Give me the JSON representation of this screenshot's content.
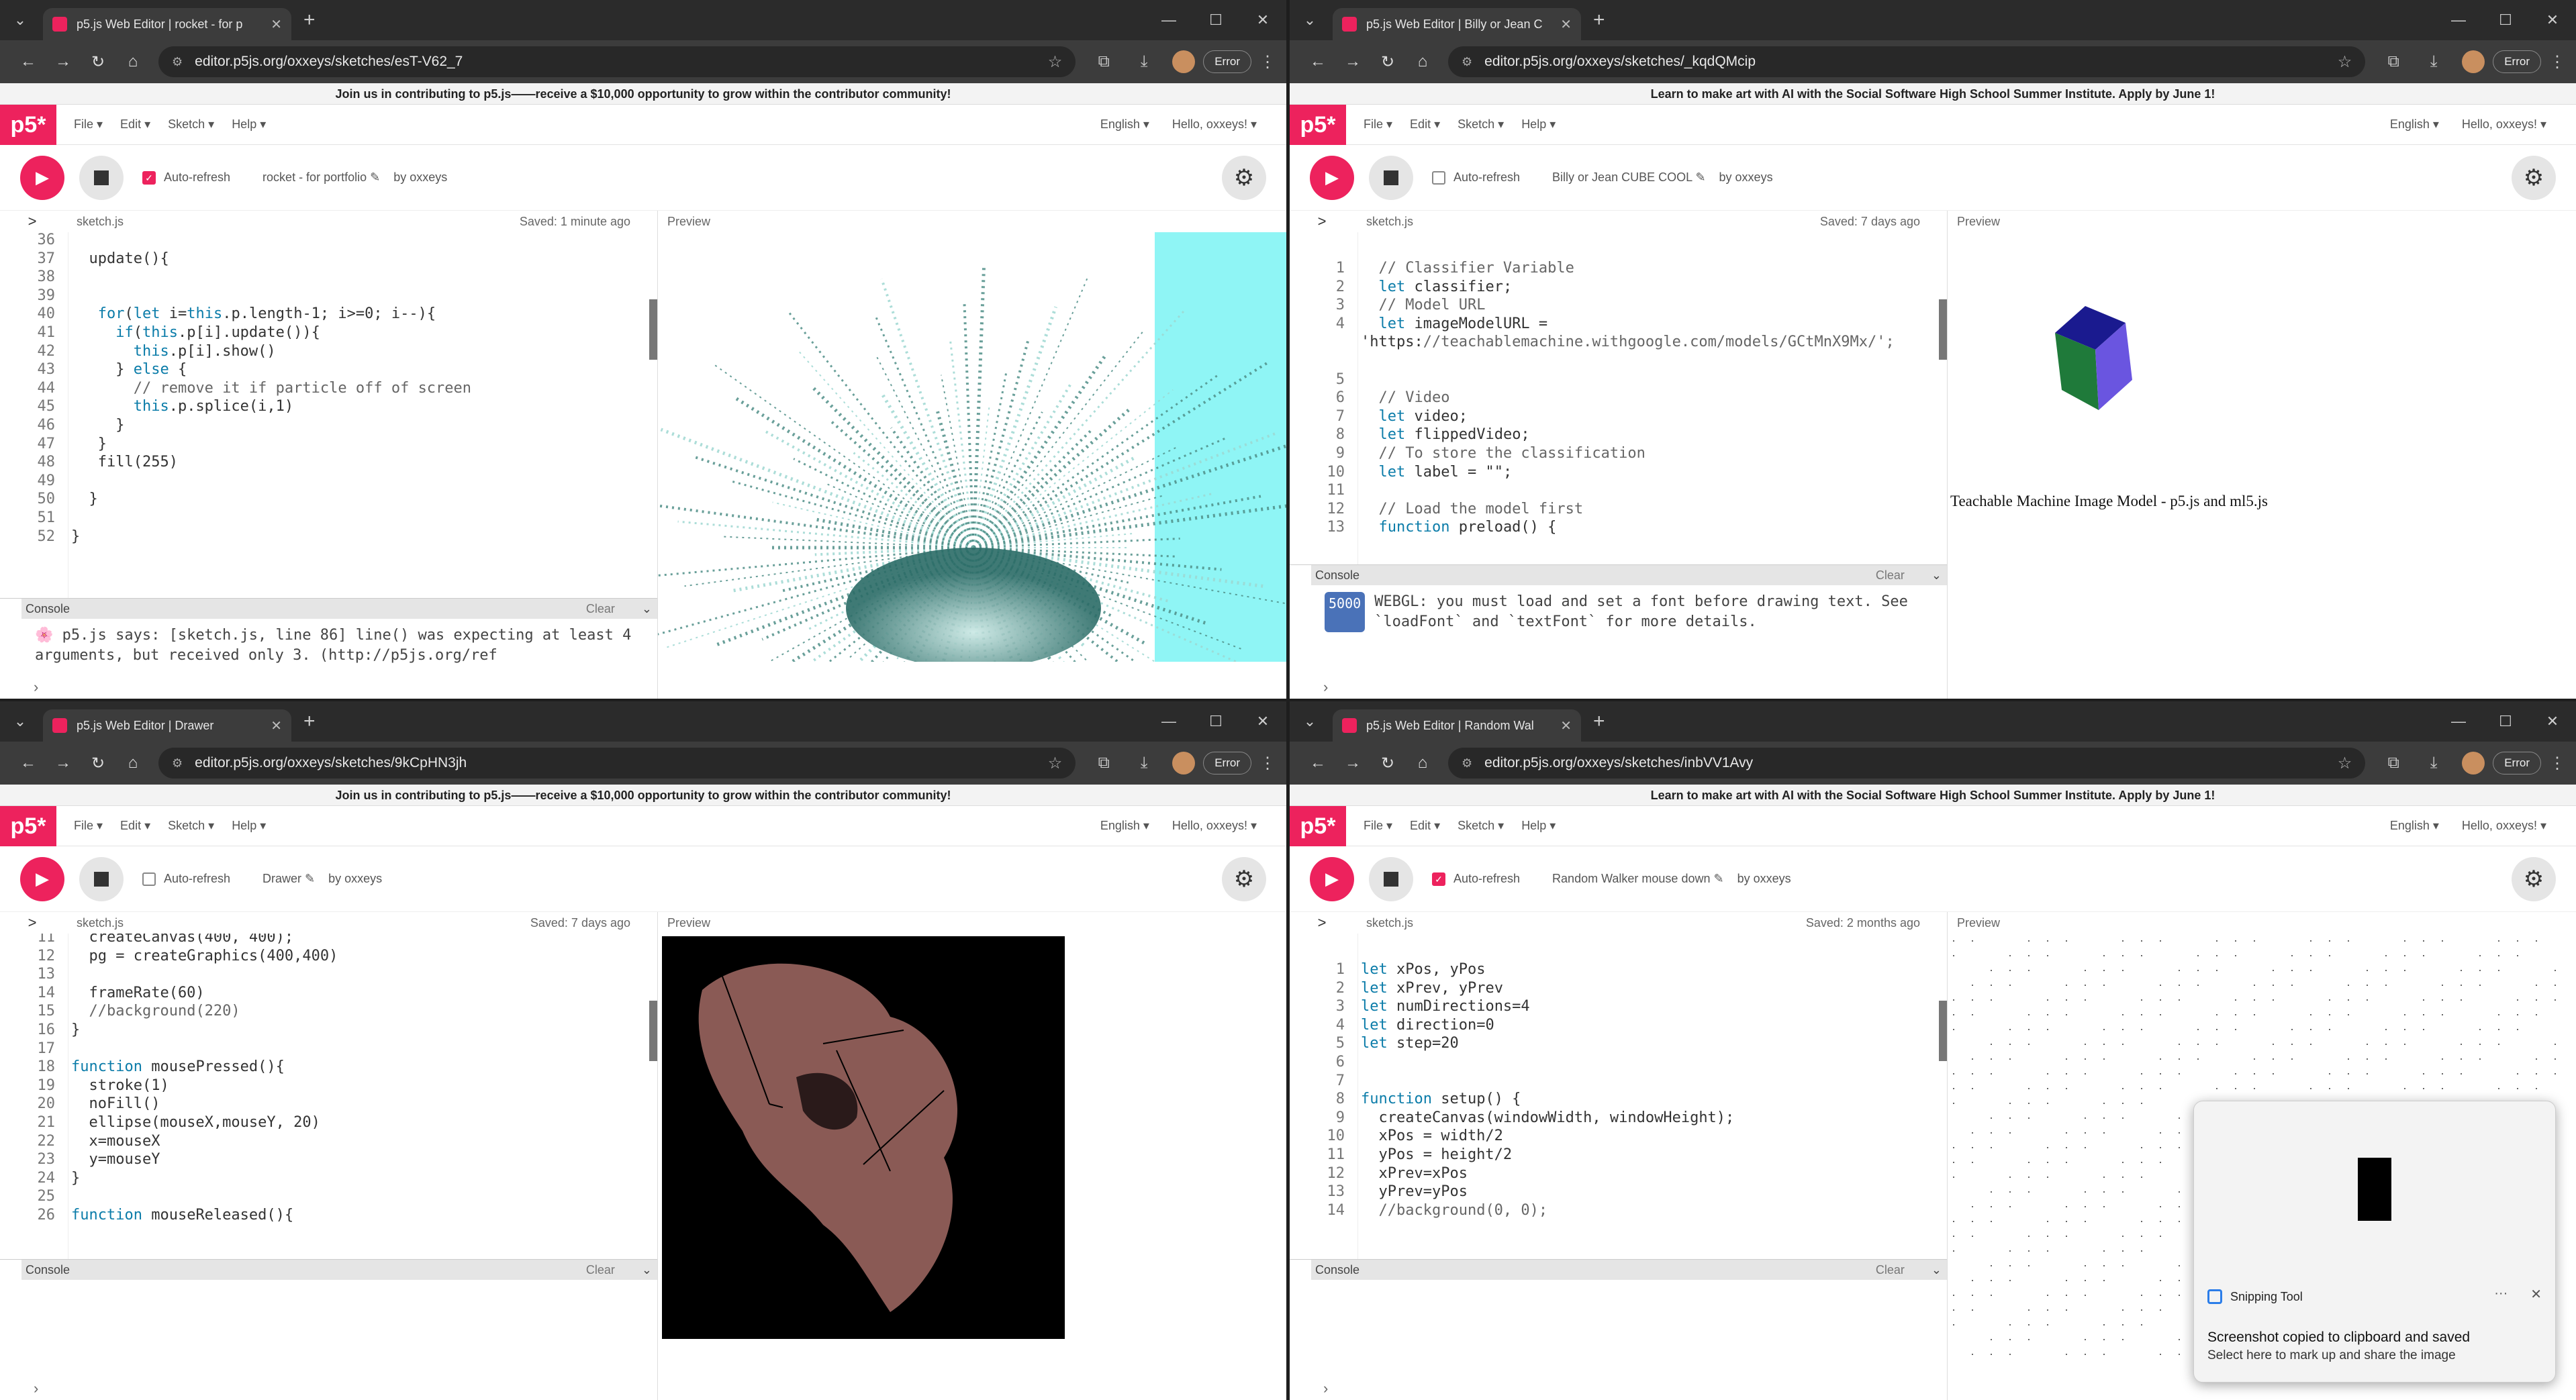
{
  "colors": {
    "p5": "#ed225d",
    "console_badge": "#4a72b8"
  },
  "common": {
    "nav": {
      "logo": "p5*",
      "file": "File ▾",
      "edit": "Edit ▾",
      "sketch": "Sketch ▾",
      "help": "Help ▾",
      "lang": "English ▾",
      "user": "Hello, oxxeys! ▾"
    },
    "auto_refresh": "Auto-refresh",
    "file_name": "sketch.js",
    "preview": "Preview",
    "console": "Console",
    "clear": "Clear",
    "error_btn": "Error"
  },
  "windows": [
    {
      "tab": "p5.js Web Editor | rocket - for p",
      "url": "editor.p5js.org/oxxeys/sketches/esT-V62_7",
      "banner": "Join us in contributing to p5.js——receive a $10,000 opportunity to grow within the contributor community!",
      "sketch": "rocket - for portfolio ✎",
      "by": "by oxxeys",
      "saved": "Saved: 1 minute ago",
      "autorefresh": true,
      "console_msg": "🌸 p5.js says: [sketch.js, line 86] line() was expecting at least 4 arguments, but received only 3. (http://p5js.org/ref"
    },
    {
      "tab": "p5.js Web Editor | Billy or Jean C",
      "url": "editor.p5js.org/oxxeys/sketches/_kqdQMcip",
      "banner": "Learn to make art with AI with the Social Software High School Summer Institute. Apply by June 1!",
      "sketch": "Billy or Jean CUBE COOL ✎",
      "by": "by oxxeys",
      "saved": "Saved: 7 days ago",
      "autorefresh": false,
      "console_badge": "5000",
      "console_msg": "WEBGL: you must load and set a font before drawing text. See `loadFont` and `textFont` for more details.",
      "preview_caption": "Teachable Machine Image Model - p5.js and ml5.js"
    },
    {
      "tab": "p5.js Web Editor | Drawer",
      "url": "editor.p5js.org/oxxeys/sketches/9kCpHN3jh",
      "banner": "Join us in contributing to p5.js——receive a $10,000 opportunity to grow within the contributor community!",
      "sketch": "Drawer ✎",
      "by": "by oxxeys",
      "saved": "Saved: 7 days ago",
      "autorefresh": false
    },
    {
      "tab": "p5.js Web Editor | Random Wal",
      "url": "editor.p5js.org/oxxeys/sketches/inbVV1Avy",
      "banner": "Learn to make art with AI with the Social Software High School Summer Institute. Apply by June 1!",
      "sketch": "Random Walker mouse down ✎",
      "by": "by oxxeys",
      "saved": "Saved: 2 months ago",
      "autorefresh": true
    }
  ],
  "code1": [
    [
      "36",
      ""
    ],
    [
      "37",
      "  update(){"
    ],
    [
      "38",
      ""
    ],
    [
      "39",
      ""
    ],
    [
      "40",
      "   for(let i=this.p.length-1; i>=0; i--){"
    ],
    [
      "41",
      "     if(this.p[i].update()){"
    ],
    [
      "42",
      "       this.p[i].show()"
    ],
    [
      "43",
      "     } else {"
    ],
    [
      "44",
      "       // remove it if particle off of screen"
    ],
    [
      "45",
      "       this.p.splice(i,1)"
    ],
    [
      "46",
      "     }"
    ],
    [
      "47",
      "   }"
    ],
    [
      "48",
      "   fill(255)"
    ],
    [
      "49",
      ""
    ],
    [
      "50",
      "  }"
    ],
    [
      "51",
      ""
    ],
    [
      "52",
      "}"
    ]
  ],
  "code2": [
    [
      "1",
      "  // Classifier Variable"
    ],
    [
      "2",
      "  let classifier;"
    ],
    [
      "3",
      "  // Model URL"
    ],
    [
      "4",
      "  let imageModelURL = "
    ],
    [
      "",
      "'https://teachablemachine.withgoogle.com/models/GCtMnX9Mx/';"
    ],
    [
      "",
      ""
    ],
    [
      "5",
      ""
    ],
    [
      "6",
      "  // Video"
    ],
    [
      "7",
      "  let video;"
    ],
    [
      "8",
      "  let flippedVideo;"
    ],
    [
      "9",
      "  // To store the classification"
    ],
    [
      "10",
      "  let label = \"\";"
    ],
    [
      "11",
      ""
    ],
    [
      "12",
      "  // Load the model first"
    ],
    [
      "13",
      "  function preload() {"
    ]
  ],
  "code3": [
    [
      "11",
      "  createCanvas(400, 400);"
    ],
    [
      "12",
      "  pg = createGraphics(400,400)"
    ],
    [
      "13",
      ""
    ],
    [
      "14",
      "  frameRate(60)"
    ],
    [
      "15",
      "  //background(220)"
    ],
    [
      "16",
      "}"
    ],
    [
      "17",
      ""
    ],
    [
      "18",
      "function mousePressed(){"
    ],
    [
      "19",
      "  stroke(1)"
    ],
    [
      "20",
      "  noFill()"
    ],
    [
      "21",
      "  ellipse(mouseX,mouseY, 20)"
    ],
    [
      "22",
      "  x=mouseX"
    ],
    [
      "23",
      "  y=mouseY"
    ],
    [
      "24",
      "}"
    ],
    [
      "25",
      ""
    ],
    [
      "26",
      "function mouseReleased(){"
    ]
  ],
  "code4": [
    [
      "1",
      "let xPos, yPos"
    ],
    [
      "2",
      "let xPrev, yPrev"
    ],
    [
      "3",
      "let numDirections=4"
    ],
    [
      "4",
      "let direction=0"
    ],
    [
      "5",
      "let step=20"
    ],
    [
      "6",
      ""
    ],
    [
      "7",
      ""
    ],
    [
      "8",
      "function setup() {"
    ],
    [
      "9",
      "  createCanvas(windowWidth, windowHeight);"
    ],
    [
      "10",
      "  xPos = width/2"
    ],
    [
      "11",
      "  yPos = height/2"
    ],
    [
      "12",
      "  xPrev=xPos"
    ],
    [
      "13",
      "  yPrev=yPos"
    ],
    [
      "14",
      "  //background(0, 0);"
    ]
  ],
  "toast": {
    "app": "Snipping Tool",
    "line1": "Screenshot copied to clipboard and saved",
    "line2": "Select here to mark up and share the image",
    "more": "···",
    "close": "✕"
  }
}
